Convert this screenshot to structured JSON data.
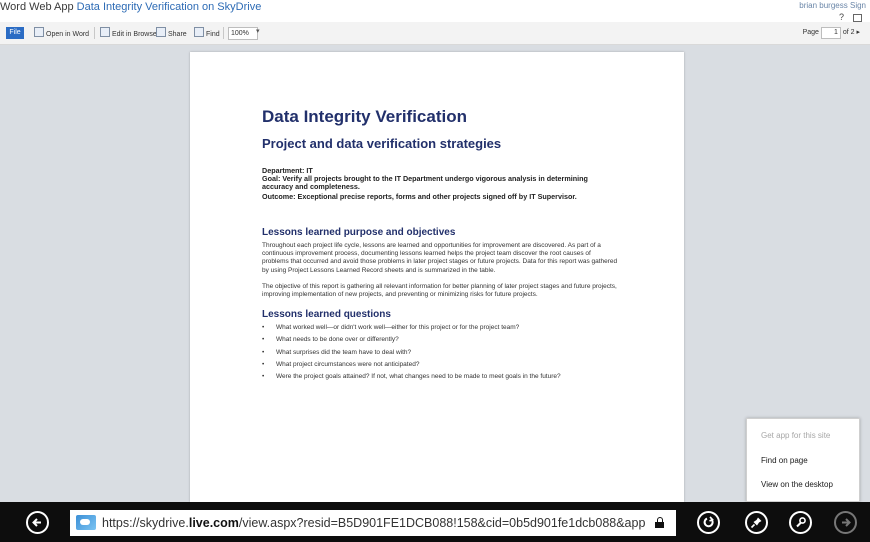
{
  "title_bar": {
    "app_name": "Word Web App",
    "doc_title": "Data Integrity Verification",
    "on_label": "on SkyDrive",
    "user": "brian burgess",
    "sign_out": "Sign",
    "help": "?"
  },
  "toolbar": {
    "file": "File",
    "open_in_word": "Open in Word",
    "edit_in_browser": "Edit in Browser",
    "share": "Share",
    "find": "Find",
    "zoom": "100%",
    "page_label": "Page",
    "page_current": "1",
    "page_of": "of 2"
  },
  "document": {
    "title": "Data Integrity Verification",
    "subtitle": "Project and data verification strategies",
    "department_label": "Department:",
    "department_value": "IT",
    "goal_label": "Goal:",
    "goal_value": "Verify all projects brought to the IT Department undergo vigorous analysis in determining accuracy and completeness.",
    "outcome_label": "Outcome:",
    "outcome_value": "Exceptional precise reports, forms and other projects signed off by IT Supervisor.",
    "section1_heading": "Lessons learned purpose and objectives",
    "section1_p1": "Throughout each project life cycle, lessons are learned and opportunities for improvement are discovered. As part of a continuous improvement process, documenting lessons learned helps the project team discover the root causes of problems that occurred and avoid those problems in later project stages or future projects. Data for this report was gathered by using Project Lessons Learned Record sheets and is summarized in the table.",
    "section1_p2": "The objective of this report is gathering all relevant information for better planning of later project stages and future projects, improving implementation of new projects, and preventing or minimizing risks for future projects.",
    "section2_heading": "Lessons learned questions",
    "questions": [
      "What worked well—or didn't work well—either for this project or for the project team?",
      "What needs to be done over or differently?",
      "What surprises did the team have to deal with?",
      "What project circumstances were not anticipated?",
      "Were the project goals attained? If not, what changes need to be made to meet goals in the future?"
    ]
  },
  "page_menu": {
    "get_app": "Get app for this site",
    "find_on_page": "Find on page",
    "view_desktop": "View on the desktop"
  },
  "address_bar": {
    "url_prefix": "https://skydrive.",
    "url_domain": "live.com",
    "url_rest": "/view.aspx?resid=B5D901FE1DCB088!158&cid=0b5d901fe1dcb088&app"
  }
}
